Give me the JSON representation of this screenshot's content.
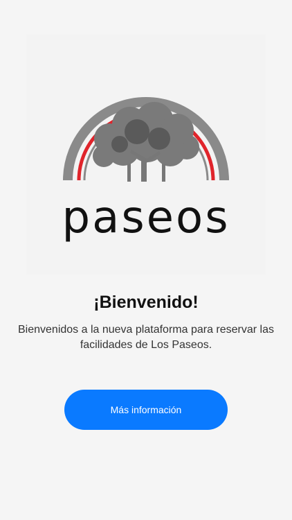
{
  "logo": {
    "brand": "paseos",
    "icon": "tree-arch-icon"
  },
  "welcome": {
    "title": "¡Bienvenido!",
    "description": "Bienvenidos a la nueva plataforma para reservar las facilidades de Los Paseos."
  },
  "actions": {
    "more_info_label": "Más información"
  },
  "colors": {
    "accent": "#0a7aff",
    "arch_gray": "#8a8a8a",
    "arch_red": "#e0242b",
    "tree": "#6e6e6e"
  }
}
